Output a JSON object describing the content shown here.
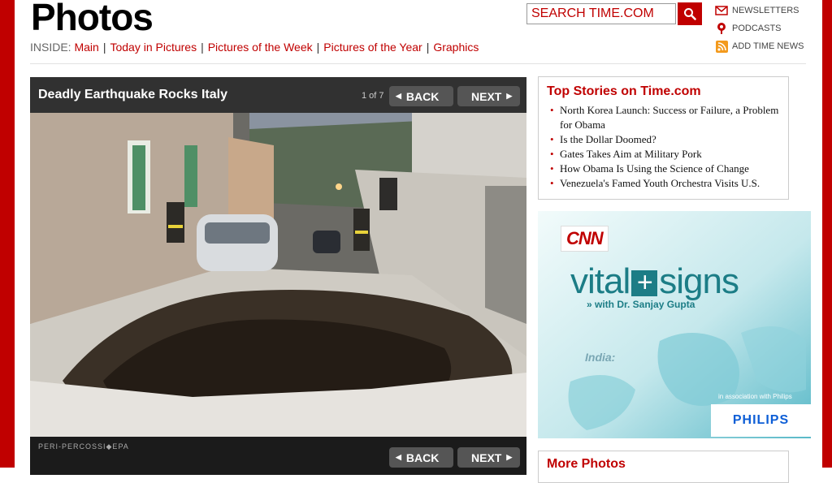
{
  "header": {
    "title": "Photos",
    "inside_label": "INSIDE:",
    "nav_links": [
      "Main",
      "Today in Pictures",
      "Pictures of the Week",
      "Pictures of the Year",
      "Graphics"
    ],
    "separator": "|"
  },
  "search": {
    "placeholder": "SEARCH TIME.COM",
    "button_icon": "magnifier-icon"
  },
  "utility_links": [
    {
      "label": "NEWSLETTERS",
      "icon": "envelope-icon"
    },
    {
      "label": "PODCASTS",
      "icon": "podcast-icon"
    },
    {
      "label": "ADD TIME NEWS",
      "icon": "rss-icon"
    }
  ],
  "gallery": {
    "title": "Deadly Earthquake Rocks Italy",
    "counter": "1 of 7",
    "back_label": "BACK",
    "next_label": "NEXT",
    "credit": "PERI-PERCOSSI◆EPA"
  },
  "top_stories": {
    "title": "Top Stories on Time.com",
    "items": [
      "North Korea Launch: Success or Failure, a Problem for Obama",
      "Is the Dollar Doomed?",
      "Gates Takes Aim at Military Pork",
      "How Obama Is Using the Science of Change",
      "Venezuela's Famed Youth Orchestra Visits U.S."
    ]
  },
  "ad": {
    "brand": "CNN",
    "headline_left": "vital",
    "headline_right": "signs",
    "subtitle": "» with Dr. Sanjay Gupta",
    "map_label": "India:",
    "association": "in association with Philips",
    "sponsor": "PHILIPS"
  },
  "more_photos": {
    "title": "More Photos"
  },
  "colors": {
    "brand_red": "#c00000",
    "ad_teal": "#1c7d86",
    "philips_blue": "#0d5ed6"
  }
}
